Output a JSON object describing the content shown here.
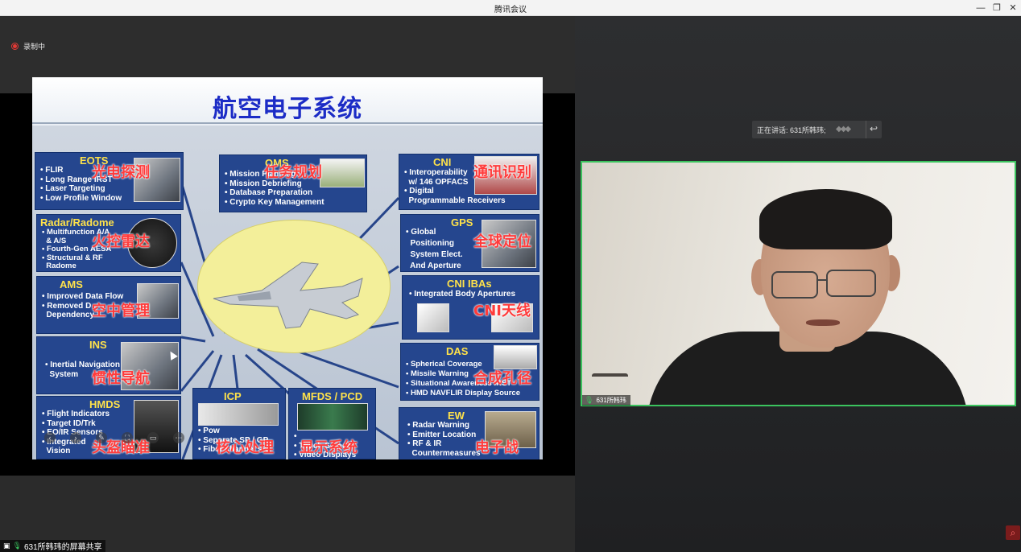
{
  "window": {
    "title": "腾讯会议",
    "minimize": "—",
    "maximize": "❐",
    "close": "✕"
  },
  "recording": {
    "label": "录制中"
  },
  "slide": {
    "title": "航空电子系统",
    "boxes": {
      "eots": {
        "header": "EOTS",
        "lines": "• FLIR\n• Long Range IRST\n• Laser Targeting\n• Low Profile Window",
        "overlay": "光电探测"
      },
      "radar": {
        "header": "Radar/Radome",
        "lines": "• Multifunction A/A\n  & A/S\n• Fourth-Gen AESA\n• Structural & RF\n  Radome",
        "overlay": "火控雷达"
      },
      "ams": {
        "header": "AMS",
        "lines": "• Improved Data Flow\n• Removed D\n  Dependency",
        "overlay": "空中管理"
      },
      "ins": {
        "header": "INS",
        "lines": "• Inertial Navigation\n  System",
        "overlay": "惯性导航"
      },
      "hmds": {
        "header": "HMDS",
        "lines": "• Flight Indicators\n• Target ID/Trk\n• EO/IR Sensors\n• Integrated\n  Vision",
        "overlay": "头盔瞄准"
      },
      "icp": {
        "header": "ICP",
        "lines": "• Pow\n• Separate SP / GP\n• Fiber channel sw",
        "overlay": "核心处理"
      },
      "mfds": {
        "header": "MFDS / PCD",
        "lines": "• \n• Touch Screen\n• Video Displays",
        "overlay": "显示系统"
      },
      "oms": {
        "header": "OMS",
        "lines": "• Mission Planning\n• Mission Debriefing\n• Database Preparation\n• Crypto Key Management",
        "overlay": "任务规划"
      },
      "cni": {
        "header": "CNI",
        "lines": "• Interoperability\n  w/ 146 OPFACS\n• Digital\n  Programmable Receivers",
        "overlay": "通讯识别"
      },
      "gps": {
        "header": "GPS",
        "lines": "• Global\n  Positioning\n  System Elect.\n  And Aperture",
        "overlay": "全球定位"
      },
      "cniiba": {
        "header": "CNI IBAs",
        "lines": "• Integrated Body Apertures",
        "overlay": "CNI天线"
      },
      "das": {
        "header": "DAS",
        "lines": "• Spherical Coverage\n• Missile Warning\n• Situational Awareness IRST\n• HMD NAVFLIR Display Source",
        "overlay": "合成孔径"
      },
      "ew": {
        "header": "EW",
        "lines": "• Radar Warning\n• Emitter Location\n• RF & IR\n  Countermeasures",
        "overlay": "电子战"
      }
    },
    "toolbar": [
      "‹",
      "›",
      "✎",
      "⛶",
      "▭",
      "⋯"
    ]
  },
  "speaking": {
    "label": "正在讲话: 631所韩玮;",
    "bars": "◆◆◆",
    "reply_icon": "↩"
  },
  "participant": {
    "name": "631所韩玮"
  },
  "share_tag": {
    "label": "631所韩玮的屏幕共享"
  },
  "colors": {
    "accent": "#3bc35e",
    "slide_title": "#1c2cc6",
    "overlay_text": "#ff3b3b",
    "box_header": "#ffe24a"
  }
}
